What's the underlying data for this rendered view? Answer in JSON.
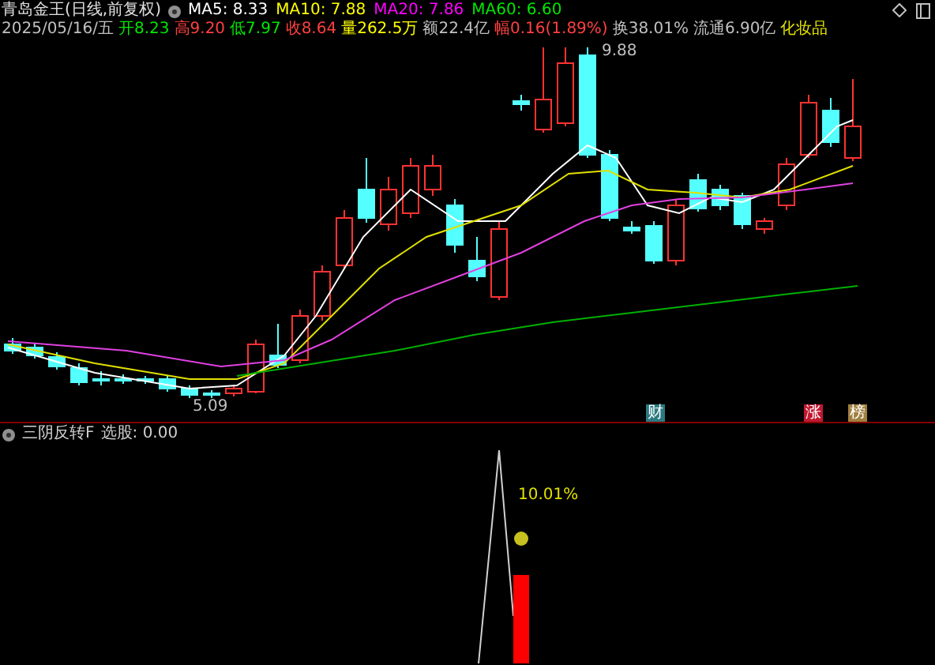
{
  "header": {
    "title": "青岛金王(日线,前复权)",
    "ma": [
      {
        "label": "MA5: 8.33",
        "color": "#ffffff"
      },
      {
        "label": "MA10: 7.88",
        "color": "#ffff00"
      },
      {
        "label": "MA20: 7.86",
        "color": "#ff00ff"
      },
      {
        "label": "MA60: 6.60",
        "color": "#00e600"
      }
    ],
    "date": "2025/05/16/五",
    "quotes": [
      {
        "text": "开8.23",
        "color": "#00e600"
      },
      {
        "text": "高9.20",
        "color": "#ff4040"
      },
      {
        "text": "低7.97",
        "color": "#00e600"
      },
      {
        "text": "收8.64",
        "color": "#ff4040"
      },
      {
        "text": "量262.5万",
        "color": "#ffff00"
      },
      {
        "text": "额22.4亿",
        "color": "#c0c0c0"
      },
      {
        "text": "幅0.16(1.89%)",
        "color": "#ff4040"
      },
      {
        "text": "换38.01%",
        "color": "#c0c0c0"
      },
      {
        "text": "流通6.90亿",
        "color": "#c0c0c0"
      }
    ],
    "sector": "化妆品"
  },
  "price_labels": [
    {
      "text": "9.88"
    },
    {
      "text": "5.09"
    }
  ],
  "event_badges": [
    {
      "text": "财",
      "color": "#2a7a80"
    },
    {
      "text": "涨",
      "color": "#c01830"
    },
    {
      "text": "榜",
      "color": "#a08040"
    }
  ],
  "indicator": {
    "name": "三阴反转F",
    "value": "选股: 0.00",
    "label": "10.01%"
  }
}
